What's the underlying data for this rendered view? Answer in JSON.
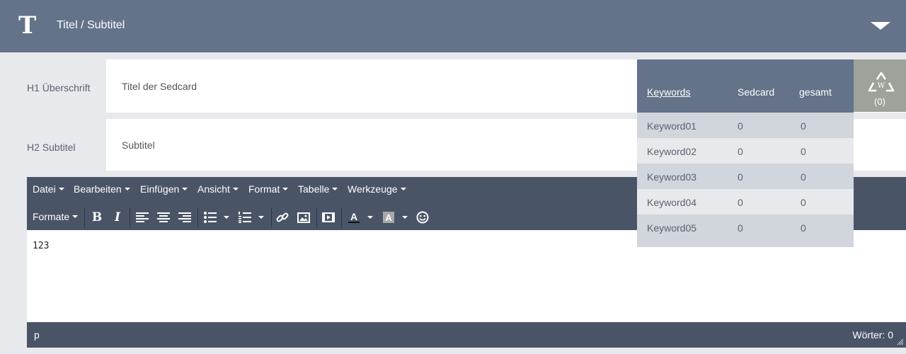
{
  "header": {
    "logo_letter": "T",
    "title": "Titel / Subtitel"
  },
  "form": {
    "h1_label": "H1 Überschrift",
    "h1_value": "Titel der Sedcard",
    "h2_label": "H2 Subtitel",
    "h2_value": "Subtitel"
  },
  "editor": {
    "menu": [
      "Datei",
      "Bearbeiten",
      "Einfügen",
      "Ansicht",
      "Format",
      "Tabelle",
      "Werkzeuge"
    ],
    "formats_label": "Formate",
    "toolbar_icons": [
      "bold-icon",
      "italic-icon",
      "align-left-icon",
      "align-center-icon",
      "align-right-icon",
      "bullet-list-icon",
      "numbered-list-icon",
      "link-icon",
      "image-icon",
      "media-icon",
      "text-color-icon",
      "background-color-icon",
      "emoticon-icon"
    ],
    "content": "123",
    "status_path": "p",
    "word_count": "Wörter: 0"
  },
  "keywords": {
    "headers": [
      "Keywords",
      "Sedcard",
      "gesamt"
    ],
    "rows": [
      {
        "keyword": "Keyword01",
        "sedcard": "0",
        "gesamt": "0"
      },
      {
        "keyword": "Keyword02",
        "sedcard": "0",
        "gesamt": "0"
      },
      {
        "keyword": "Keyword03",
        "sedcard": "0",
        "gesamt": "0"
      },
      {
        "keyword": "Keyword04",
        "sedcard": "0",
        "gesamt": "0"
      },
      {
        "keyword": "Keyword05",
        "sedcard": "0",
        "gesamt": "0"
      }
    ]
  },
  "recycle": {
    "icon": "recycle-icon",
    "letter": "W",
    "count": "(0)"
  },
  "colors": {
    "header_bg": "#64728a",
    "editor_bar_bg": "#4a5467",
    "page_bg": "#e8e9ec",
    "recycle_bg": "#9da39b"
  }
}
